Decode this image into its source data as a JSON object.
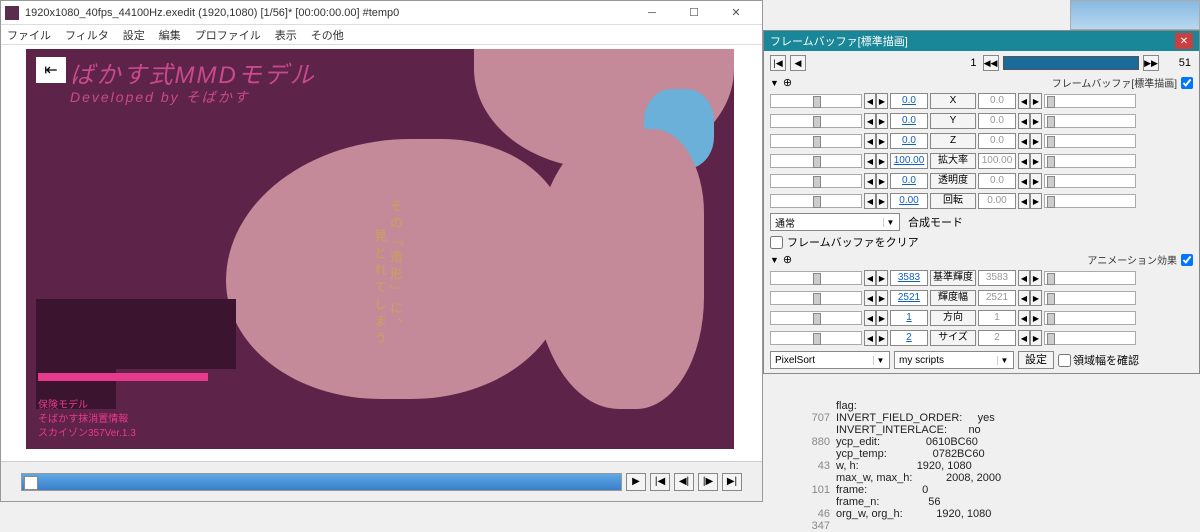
{
  "window": {
    "title": "1920x1080_40fps_44100Hz.exedit (1920,1080) [1/56]* [00:00:00.00] #temp0",
    "menu": [
      "ファイル",
      "フィルタ",
      "設定",
      "編集",
      "プロファイル",
      "表示",
      "その他"
    ]
  },
  "preview": {
    "headline": "ばかす式MMDモデル",
    "subline": "Developed by そばかす",
    "vtext1": "その「造形」に、",
    "vtext2": "見とれてしまう",
    "credits": "保険モデル\nそばかす抹消置情報\nスカイゾン357Ver.1.3"
  },
  "playback": {
    "play": "▶",
    "prev": "|◀",
    "prev2": "◀|",
    "next": "|▶",
    "next2": "▶|"
  },
  "panel": {
    "title": "フレームバッファ[標準描画]",
    "frame_cur": "1",
    "frame_end": "51",
    "sec1_label": "フレームバッファ[標準描画]",
    "sec2_label": "アニメーション効果",
    "rows": [
      {
        "v": "0.0",
        "lbl": "X",
        "v2": "0.0"
      },
      {
        "v": "0.0",
        "lbl": "Y",
        "v2": "0.0"
      },
      {
        "v": "0.0",
        "lbl": "Z",
        "v2": "0.0"
      },
      {
        "v": "100.00",
        "lbl": "拡大率",
        "v2": "100.00"
      },
      {
        "v": "0.0",
        "lbl": "透明度",
        "v2": "0.0"
      },
      {
        "v": "0.00",
        "lbl": "回転",
        "v2": "0.00"
      }
    ],
    "blend_combo": "通常",
    "blend_label": "合成モード",
    "clear_chk": "フレームバッファをクリア",
    "rows2": [
      {
        "v": "3583",
        "lbl": "基準輝度",
        "v2": "3583"
      },
      {
        "v": "2521",
        "lbl": "輝度幅",
        "v2": "2521"
      },
      {
        "v": "1",
        "lbl": "方向",
        "v2": "1"
      },
      {
        "v": "2",
        "lbl": "サイズ",
        "v2": "2"
      }
    ],
    "script_combo": "PixelSort",
    "folder_combo": "my scripts",
    "setting_btn": "設定",
    "region_chk": "領域幅を確認"
  },
  "debug": [
    {
      "n": "",
      "k": "flag:",
      "v": ""
    },
    {
      "n": "707",
      "k": "INVERT_FIELD_ORDER:",
      "v": "yes"
    },
    {
      "n": "",
      "k": "INVERT_INTERLACE:",
      "v": "no"
    },
    {
      "n": "880",
      "k": "ycp_edit:",
      "v": "0610BC60"
    },
    {
      "n": "",
      "k": "ycp_temp:",
      "v": "0782BC60"
    },
    {
      "n": "43",
      "k": "w, h:",
      "v": "1920, 1080"
    },
    {
      "n": "",
      "k": "max_w, max_h:",
      "v": "2008, 2000"
    },
    {
      "n": "101",
      "k": "frame:",
      "v": "0"
    },
    {
      "n": "",
      "k": "frame_n:",
      "v": "56"
    },
    {
      "n": "46",
      "k": "org_w, org_h:",
      "v": "1920, 1080"
    },
    {
      "n": "347",
      "k": "",
      "v": ""
    }
  ]
}
